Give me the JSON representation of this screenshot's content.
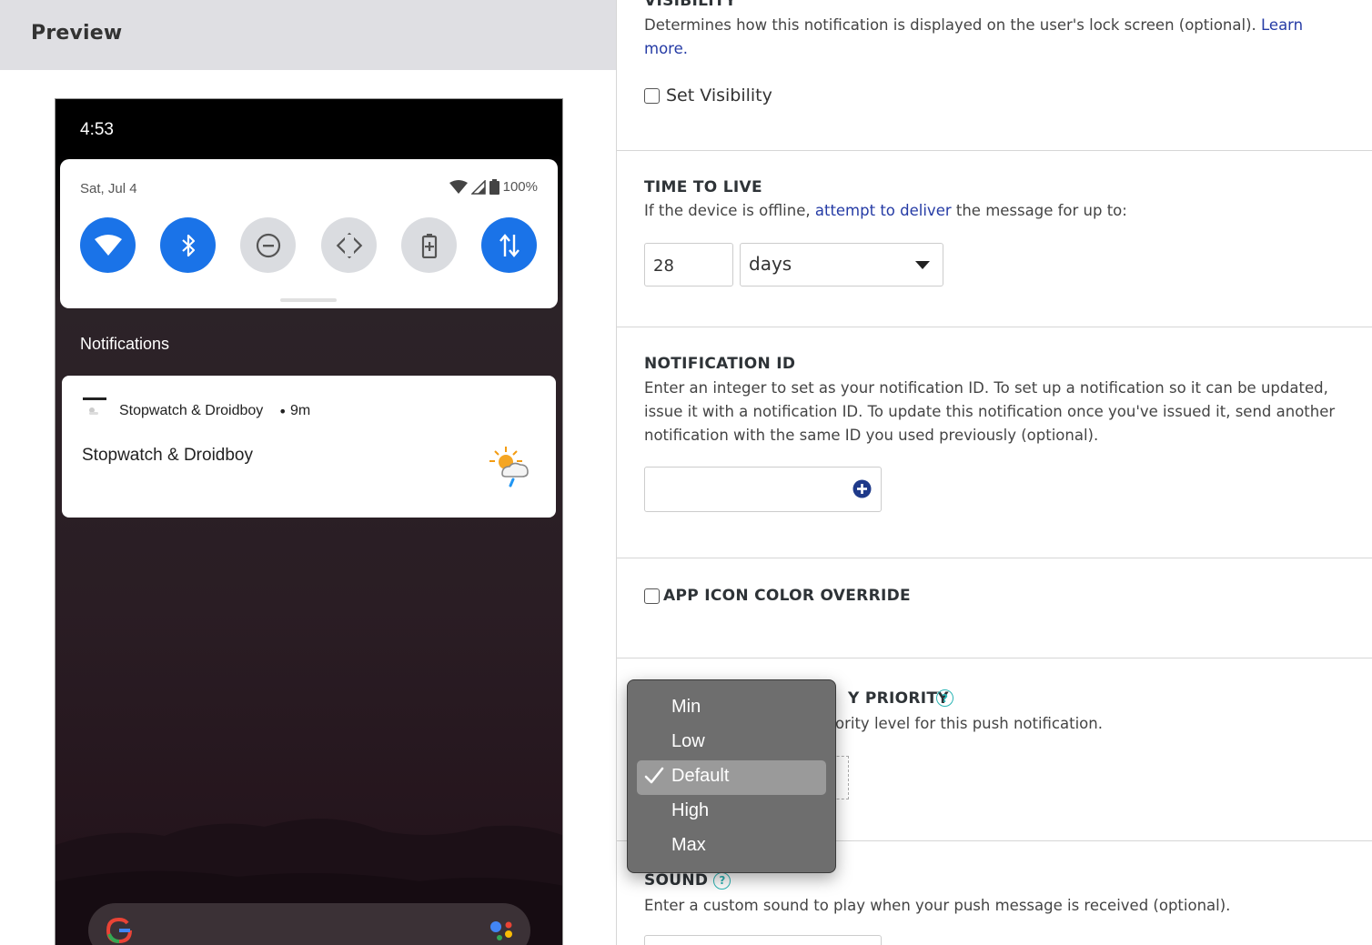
{
  "preview": {
    "header_title": "Preview",
    "phone": {
      "time": "4:53",
      "quick_settings": {
        "date": "Sat, Jul 4",
        "battery": "100%",
        "tiles": [
          {
            "icon": "wifi-icon",
            "state": "on"
          },
          {
            "icon": "bluetooth-icon",
            "state": "on"
          },
          {
            "icon": "do-not-disturb-icon",
            "state": "off"
          },
          {
            "icon": "auto-rotate-icon",
            "state": "off"
          },
          {
            "icon": "battery-saver-icon",
            "state": "off"
          },
          {
            "icon": "mobile-data-icon",
            "state": "on"
          }
        ]
      },
      "notifications_heading": "Notifications",
      "notification": {
        "app_name": "Stopwatch & Droidboy",
        "separator": "•",
        "time_ago": "9m",
        "title": "Stopwatch & Droidboy",
        "large_icon": "weather-partly-cloudy-icon"
      }
    }
  },
  "form": {
    "visibility": {
      "title": "VISIBILITY",
      "description": "Determines how this notification is displayed on the user's lock screen (optional).",
      "link": "Learn more.",
      "checkbox_label": "Set Visibility"
    },
    "ttl": {
      "title": "TIME TO LIVE",
      "desc_before": "If the device is offline,",
      "desc_link": "attempt to deliver",
      "desc_after": "the message for up to:",
      "value": "28",
      "unit": "days"
    },
    "notification_id": {
      "title": "NOTIFICATION ID",
      "description": "Enter an integer to set as your notification ID. To set up a notification so it can be updated, issue it with a notification ID. To update this notification once you've issued it, send another notification with the same ID you used previously (optional).",
      "value": ""
    },
    "app_icon": {
      "title": "APP ICON COLOR OVERRIDE"
    },
    "priority": {
      "title_visible": "Y PRIORITY",
      "desc_visible": "ority level for this push notification.",
      "help": "?"
    },
    "sound": {
      "title": "SOUND",
      "help": "?",
      "description": "Enter a custom sound to play when your push message is received (optional)."
    }
  },
  "priority_menu": {
    "options": [
      "Min",
      "Low",
      "Default",
      "High",
      "Max"
    ],
    "selected": "Default"
  },
  "colors": {
    "accent_blue": "#1a73e8",
    "link": "#253ba5",
    "help_teal": "#2bb5b5",
    "menu_bg": "#6e6e6e"
  }
}
